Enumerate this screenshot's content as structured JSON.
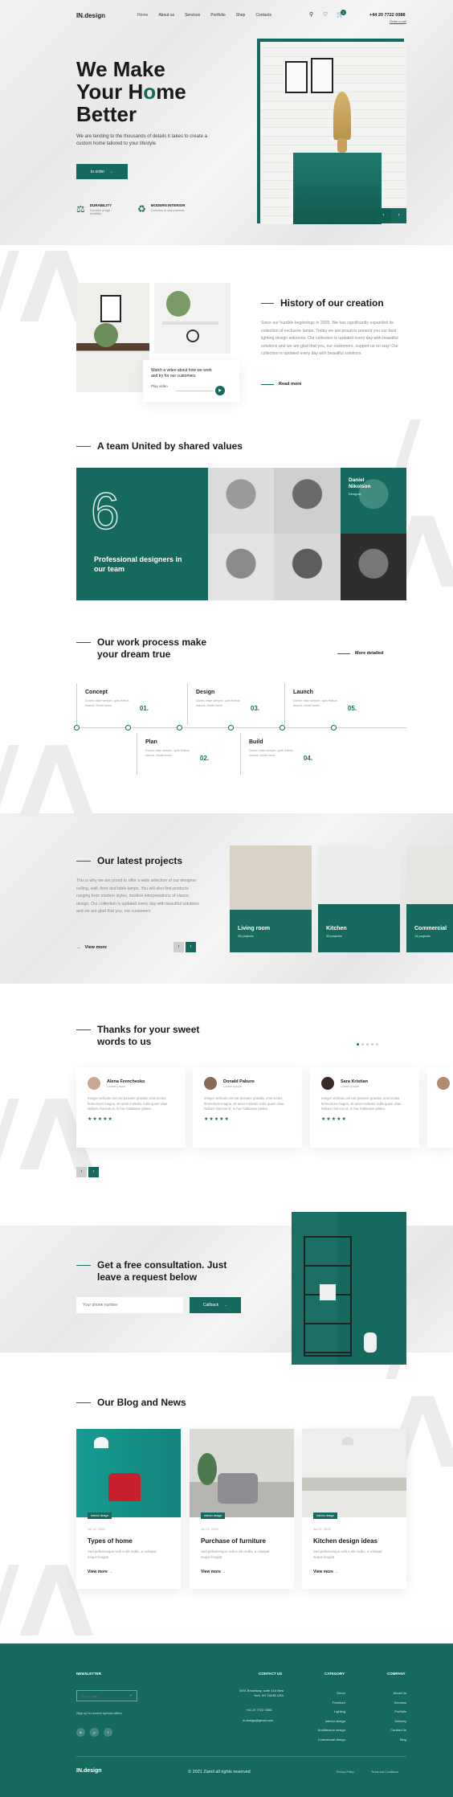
{
  "header": {
    "logo": "IN.design",
    "nav": [
      "Home",
      "About us",
      "Services",
      "Portfolio",
      "Shop",
      "Contacts"
    ],
    "cart_count": "2",
    "phone": "+44 20 7722 0088",
    "order_call": "Order a call"
  },
  "hero": {
    "line1": "We Make",
    "line2a": "Your H",
    "line2b": "me",
    "line3": "Better",
    "subtitle": "We are tending to the thousands of details it takes to create a custom home tailored to your lifestyle",
    "cta": "to order",
    "features": [
      {
        "title": "DURABILITY",
        "desc": "Furniture of high durability"
      },
      {
        "title": "MODERN INTERIOR",
        "desc": "Collection of new materials"
      }
    ]
  },
  "history": {
    "title": "History of our creation",
    "text": "Since our humble beginnings in 2005, We has significantly expanded its collection of exclusive lamps. Today we are proud to present you our best lighting design solutions. Our collection is updated every day with beautiful solutions and we are glad that you, our customers, support us on way! Our collection is updated every day with beautiful solutions",
    "read_more": "Read more",
    "video_title": "Watch a video about how we work and try for our customers",
    "video_label": "Play video"
  },
  "team": {
    "title": "A team United by shared values",
    "count": "6",
    "caption": "Professional designers in our team",
    "featured_name": "Daniel Nikolson",
    "featured_role": "Designer"
  },
  "process": {
    "title": "Our work process make your dream true",
    "more": "More detailed",
    "steps": [
      {
        "num": "01.",
        "title": "Concept",
        "desc": "Donec vitae semper, quis finibus mauris. Morbi tortor"
      },
      {
        "num": "02.",
        "title": "Plan",
        "desc": "Donec vitae semper, quis finibus mauris. Morbi tortor"
      },
      {
        "num": "03.",
        "title": "Design",
        "desc": "Donec vitae semper, quis finibus mauris. Morbi tortor"
      },
      {
        "num": "04.",
        "title": "Build",
        "desc": "Donec vitae semper, quis finibus mauris. Morbi tortor"
      },
      {
        "num": "05.",
        "title": "Launch",
        "desc": "Donec vitae semper, quis finibus mauris. Morbi tortor"
      }
    ]
  },
  "projects": {
    "title": "Our latest projects",
    "text": "This is why we are proud to offer a wide selection of our designer ceiling, wall, floor and table lamps. You will also find products ranging from modern styles, modern interpretations of classic design. Our collection is updated every day with beautiful solutions and we are glad that you, our customers",
    "view_more": "View more",
    "items": [
      {
        "name": "Living room",
        "count": "26 projects"
      },
      {
        "name": "Kitchen",
        "count": "35 projects"
      },
      {
        "name": "Commercial",
        "count": "14 projects"
      }
    ]
  },
  "testimonials": {
    "title": "Thanks for your sweet words to us",
    "items": [
      {
        "name": "Alena Frenchesko",
        "role": "Lorem ipsum",
        "text": "Integer vehicula vel nisi posuere gravida, eros lectus fermentum magna, sit amet molestie nulla quam vitae. Nullam rhoncus id, in hac habitasse platea."
      },
      {
        "name": "Donald Pabure",
        "role": "Lorem ipsum",
        "text": "Integer vehicula vel nisi posuere gravida, eros lectus fermentum magna, sit amet molestie nulla quam vitae. Nullam rhoncus id, in hac habitasse platea."
      },
      {
        "name": "Sara Kristian",
        "role": "Lorem ipsum",
        "text": "Integer vehicula vel nisi posuere gravida, eros lectus fermentum magna, sit amet molestie nulla quam vitae. Nullam rhoncus id, in hac habitasse platea."
      }
    ]
  },
  "consult": {
    "title": "Get a free consultation. Just leave a request below",
    "placeholder": "Your phone number",
    "button": "Callback"
  },
  "blog": {
    "title": "Our Blog and News",
    "items": [
      {
        "tag": "Interior design",
        "date": "Jul 22, 2020",
        "title": "Types of home",
        "desc": "Sed pellentesque velit a elit mollis, a volutpat neque feugiat",
        "more": "View more"
      },
      {
        "tag": "Interior design",
        "date": "Jul 22, 2020",
        "title": "Purchase of furniture",
        "desc": "Sed pellentesque velit a elit mollis, a volutpat neque feugiat",
        "more": "View more"
      },
      {
        "tag": "Interior design",
        "date": "Jul 22, 2020",
        "title": "Kitchen design ideas",
        "desc": "Sed pellentesque velit a elit mollis, a volutpat neque feugiat",
        "more": "View more"
      }
    ]
  },
  "footer": {
    "newsletter_title": "NEWSLETTER",
    "email_placeholder": "Your e-mail",
    "newsletter_note": "Sign up to receive special offers",
    "contact_title": "CONTACT US",
    "address": "3091 Broadway, suite 416 New York, NY 10036 USA",
    "phone": "+44 20 7722 0088",
    "email": "in.design@gmail.com",
    "category_title": "CATEGORY",
    "category": [
      "Decor",
      "Furniture",
      "Lighting",
      "Interior design",
      "Architecture design",
      "Commercial design"
    ],
    "company_title": "COMPANY",
    "company": [
      "About Us",
      "Services",
      "Portfolio",
      "Delivery",
      "Contact Us",
      "Blog"
    ],
    "logo": "IN.design",
    "copyright": "© 2021 Zamil all rights reserved",
    "privacy": "Privacy Policy",
    "terms": "Terms and Conditions"
  }
}
